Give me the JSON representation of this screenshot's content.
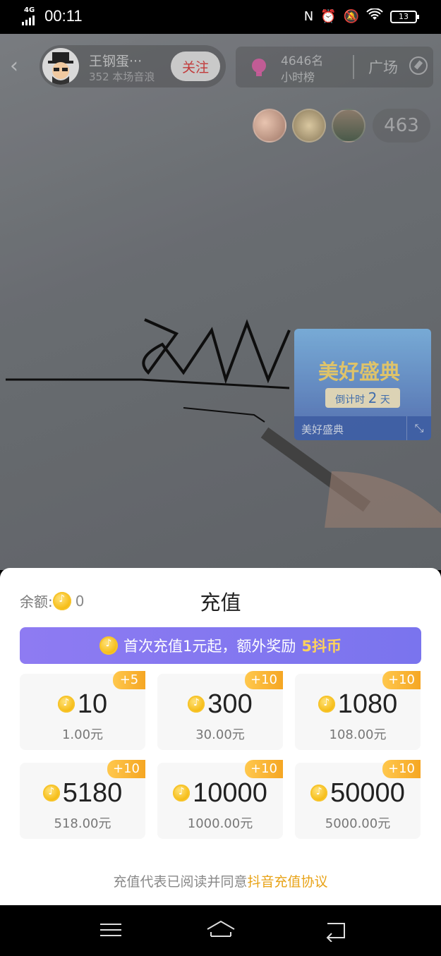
{
  "status_bar": {
    "network": "4G",
    "time": "00:11",
    "battery": "13",
    "icons": [
      "nfc-icon",
      "alarm-icon",
      "mute-icon",
      "wifi-icon",
      "battery-icon"
    ]
  },
  "live": {
    "host_name": "王钢蛋···",
    "host_sub": "352 本场音浪",
    "follow_label": "关注",
    "rank_count": "4646名",
    "rank_label": "小时榜",
    "plaza_label": "广场",
    "viewer_count": "463",
    "event": {
      "title": "美好盛典",
      "countdown_prefix": "倒计时",
      "countdown_days": "2",
      "countdown_unit": "天",
      "name": "美好盛典"
    }
  },
  "recharge": {
    "balance_label": "余额:",
    "balance_value": "0",
    "title": "充值",
    "promo_text": "首次充值1元起，额外奖励",
    "promo_highlight": "5抖币",
    "packages": [
      {
        "bonus": "+5",
        "coins": "10",
        "price": "1.00元"
      },
      {
        "bonus": "+10",
        "coins": "300",
        "price": "30.00元"
      },
      {
        "bonus": "+10",
        "coins": "1080",
        "price": "108.00元"
      },
      {
        "bonus": "+10",
        "coins": "5180",
        "price": "518.00元"
      },
      {
        "bonus": "+10",
        "coins": "10000",
        "price": "1000.00元"
      },
      {
        "bonus": "+10",
        "coins": "50000",
        "price": "5000.00元"
      }
    ],
    "agreement_text": "充值代表已阅读并同意",
    "agreement_link": "抖音充值协议"
  },
  "nav": {
    "items": [
      "menu",
      "home",
      "back"
    ]
  },
  "colors": {
    "promo_gradient_start": "#8e7bf2",
    "promo_gradient_end": "#7a74ee",
    "bonus_badge": "#f5a623",
    "link": "#e8a317",
    "follow_text": "#c23a3a"
  }
}
